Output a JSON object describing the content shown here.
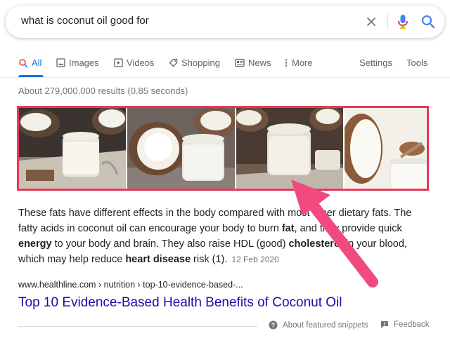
{
  "search": {
    "query": "what is coconut oil good for"
  },
  "icons": {
    "clear": "close-icon",
    "mic": "microphone-icon",
    "search": "search-icon"
  },
  "tabs": [
    {
      "label": "All",
      "icon": "search-icon",
      "active": true
    },
    {
      "label": "Images",
      "icon": "image-icon"
    },
    {
      "label": "Videos",
      "icon": "play-icon"
    },
    {
      "label": "Shopping",
      "icon": "tag-icon"
    },
    {
      "label": "News",
      "icon": "news-icon"
    },
    {
      "label": "More",
      "icon": "more-vert-icon"
    },
    {
      "label": "Settings"
    },
    {
      "label": "Tools"
    }
  ],
  "result_stats": "About 279,000,000 results (0.85 seconds)",
  "featured_snippet": {
    "text_1": "These fats have different effects in the body compared with most other dietary fats. The fatty acids in coconut oil can encourage your body to burn ",
    "bold_1": "fat",
    "text_2": ", and they provide quick ",
    "bold_2": "energy",
    "text_3": " to your body and brain. They also raise HDL (good) ",
    "bold_3": "cholesterol",
    "text_4": " in your blood, which may help reduce ",
    "bold_4": "heart disease",
    "text_5": " risk (1).",
    "date": "12 Feb 2020"
  },
  "result": {
    "breadcrumb": "www.healthline.com › nutrition › top-10-evidence-based-...",
    "title": "Top 10 Evidence-Based Health Benefits of Coconut Oil"
  },
  "footer": {
    "about_label": "About featured snippets",
    "feedback_label": "Feedback"
  },
  "colors": {
    "accent": "#1a73e8",
    "link": "#1a0dab",
    "highlight": "#e8375a"
  }
}
